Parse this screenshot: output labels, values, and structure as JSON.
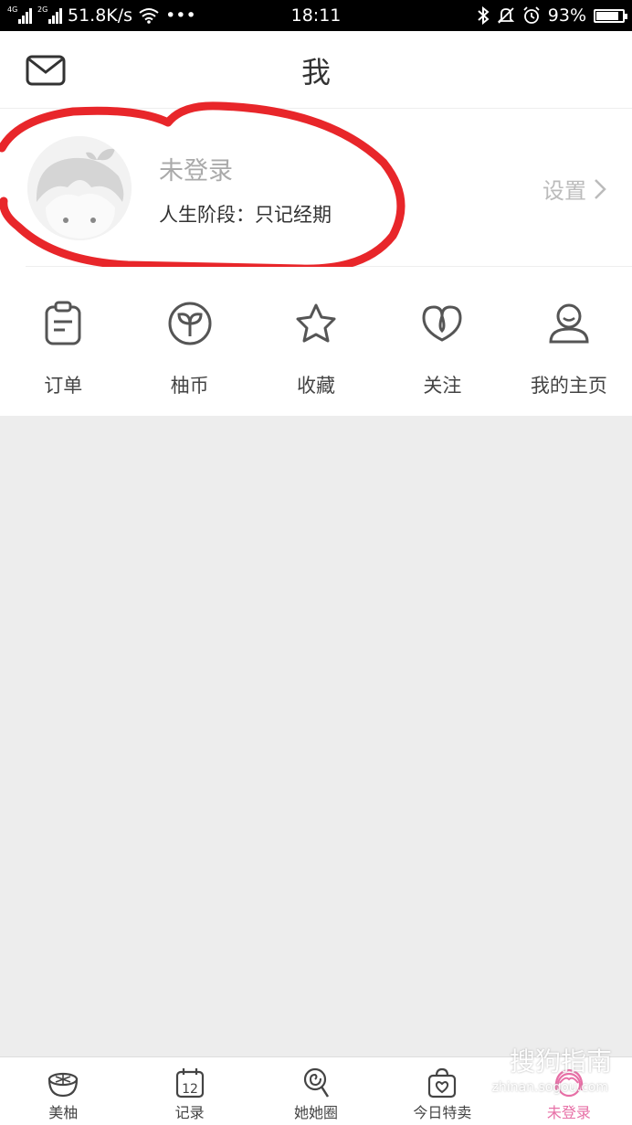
{
  "status_bar": {
    "network_1": "4G",
    "network_2": "2G",
    "speed": "51.8K/s",
    "more": "•••",
    "time": "18:11",
    "battery": "93%",
    "battery_level": 0.93
  },
  "header": {
    "title": "我",
    "mail_icon": "mail-icon"
  },
  "profile": {
    "name": "未登录",
    "stage": "人生阶段：只记经期",
    "settings_label": "设置",
    "avatar_icon": "girl-avatar-icon"
  },
  "quick_actions": [
    {
      "label": "订单",
      "icon": "clipboard-icon"
    },
    {
      "label": "柚币",
      "icon": "sprout-coin-icon"
    },
    {
      "label": "收藏",
      "icon": "star-icon"
    },
    {
      "label": "关注",
      "icon": "heart-icon"
    },
    {
      "label": "我的主页",
      "icon": "person-icon"
    }
  ],
  "tabs": [
    {
      "label": "美柚",
      "icon": "pomelo-icon",
      "active": false
    },
    {
      "label": "记录",
      "icon": "calendar-icon",
      "calendar_day": "12",
      "active": false
    },
    {
      "label": "她她圈",
      "icon": "lollipop-icon",
      "active": false
    },
    {
      "label": "今日特卖",
      "icon": "shopping-bag-icon",
      "active": false
    },
    {
      "label": "未登录",
      "icon": "girl-icon",
      "active": true
    }
  ],
  "watermark": {
    "text": "搜狗指南",
    "url": "zhinan.sogou.com"
  },
  "colors": {
    "accent": "#e76fa6",
    "annotation": "#e8262a",
    "background": "#ededed"
  }
}
